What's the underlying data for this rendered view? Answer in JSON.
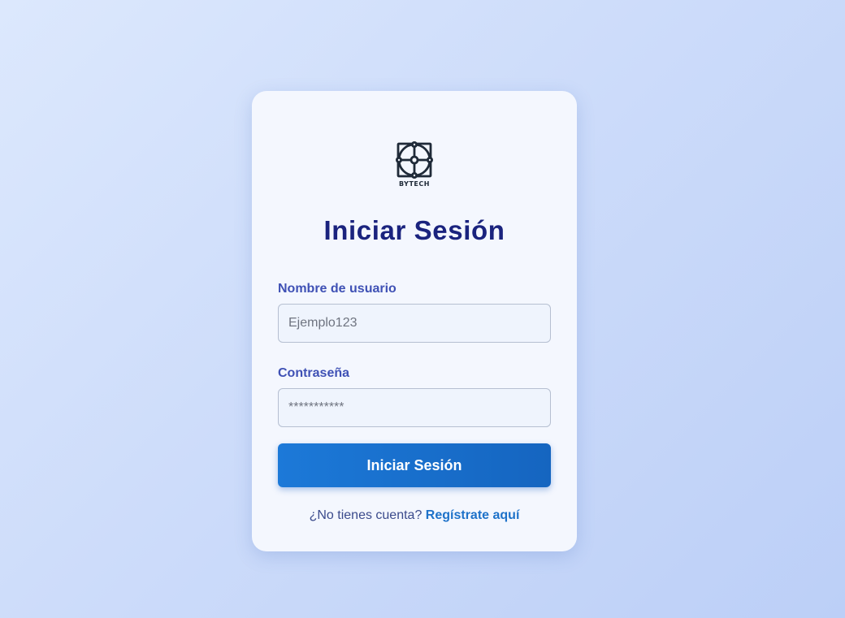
{
  "logo": {
    "text": "BYTECH",
    "icon": "bytech-logo-icon",
    "color": "#1f2a38"
  },
  "login": {
    "title": "Iniciar Sesión",
    "username_label": "Nombre de usuario",
    "username_placeholder": "Ejemplo123",
    "password_label": "Contraseña",
    "password_placeholder": "***********",
    "submit_label": "Iniciar Sesión",
    "no_account_text": "¿No tienes cuenta?",
    "register_link": "Regístrate aquí"
  },
  "colors": {
    "title": "#1a237e",
    "label": "#3f51b5",
    "button": "#1976d2",
    "link": "#1e72c9"
  }
}
